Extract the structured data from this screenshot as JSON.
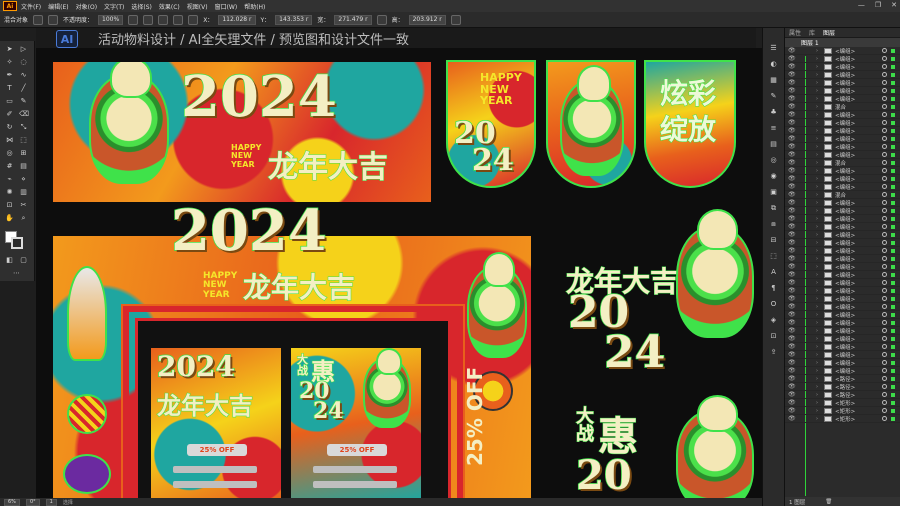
{
  "app": {
    "logo": "Ai",
    "menu": [
      "文件(F)",
      "编辑(E)",
      "对象(O)",
      "文字(T)",
      "选择(S)",
      "效果(C)",
      "视图(V)",
      "窗口(W)",
      "帮助(H)"
    ],
    "window_controls": [
      "—",
      "❐",
      "✕"
    ]
  },
  "control_bar": {
    "selection_label": "混合对象",
    "opacity_label": "不透明度：",
    "opacity_value": "100%",
    "x_label": "X：",
    "x_value": "112.028 r",
    "y_label": "Y：",
    "y_value": "143.353 r",
    "w_label": "宽：",
    "w_value": "271.479 r",
    "h_label": "高：",
    "h_value": "203.912 r"
  },
  "document": {
    "badge": "AI",
    "title": "活动物料设计 / AI全矢理文件 / 预览图和设计文件一致"
  },
  "artwork": {
    "year": "2024",
    "year_split_top": "20",
    "year_split_bottom": "24",
    "happy_new_year": [
      "HAPPY",
      "NEW",
      "YEAR"
    ],
    "slogan_dragon": "龙年大吉",
    "slogan_colorful": [
      "炫彩",
      "绽放"
    ],
    "slogan_sale_small": [
      "大",
      "战"
    ],
    "slogan_sale_big": "惠",
    "discount": "25% OFF",
    "discount_vertical": "25% OFF"
  },
  "layers_panel": {
    "tabs": [
      "属性",
      "库",
      "图层"
    ],
    "active_tab": "图层",
    "top_layer": "图层 1",
    "rows": [
      "<编组>",
      "<编组>",
      "<编组>",
      "<编组>",
      "<编组>",
      "<编组>",
      "<编组>",
      "混合",
      "<编组>",
      "<编组>",
      "<编组>",
      "<编组>",
      "<编组>",
      "<编组>",
      "混合",
      "<编组>",
      "<编组>",
      "<编组>",
      "混合",
      "<编组>",
      "<编组>",
      "<编组>",
      "<编组>",
      "<编组>",
      "<编组>",
      "<编组>",
      "<编组>",
      "<编组>",
      "<编组>",
      "<编组>",
      "<编组>",
      "<编组>",
      "<编组>",
      "<编组>",
      "<编组>",
      "<编组>",
      "<编组>",
      "<编组>",
      "<编组>",
      "<编组>",
      "<编组>",
      "<路径>",
      "<路径>",
      "<路径>",
      "<矩形>",
      "<矩形>",
      "<矩形>"
    ],
    "footer_label": "1 图层"
  },
  "status": {
    "zoom": "6%",
    "angle": "0°",
    "page": "1",
    "tool": "选择"
  },
  "colors": {
    "accent_green": "#3fe24a",
    "orange": "#e8601c",
    "red": "#d8262c",
    "teal": "#1fa6a0",
    "yellow": "#f5d21a"
  }
}
